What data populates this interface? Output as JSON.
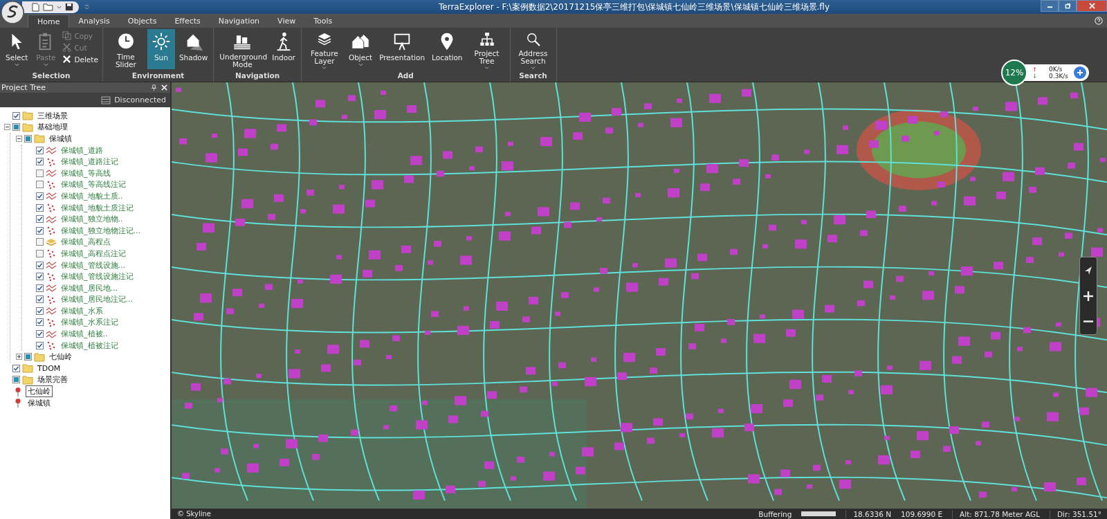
{
  "window": {
    "title": "TerraExplorer - F:\\案例数据2\\20171215保亭三维打包\\保城镇七仙岭三维场景\\保城镇七仙岭三维场景.fly"
  },
  "tabs": [
    {
      "label": "Home",
      "selected": true
    },
    {
      "label": "Analysis",
      "selected": false
    },
    {
      "label": "Objects",
      "selected": false
    },
    {
      "label": "Effects",
      "selected": false
    },
    {
      "label": "Navigation",
      "selected": false
    },
    {
      "label": "View",
      "selected": false
    },
    {
      "label": "Tools",
      "selected": false
    }
  ],
  "ribbon": [
    {
      "group": "Selection",
      "buttons": [
        {
          "kind": "large",
          "label": "Select",
          "dropdown": true,
          "disabled": false,
          "selected": false
        },
        {
          "kind": "large",
          "label": "Paste",
          "dropdown": true,
          "disabled": true,
          "selected": false
        },
        {
          "kind": "small",
          "label": "Copy",
          "disabled": true
        },
        {
          "kind": "small",
          "label": "Cut",
          "disabled": true
        },
        {
          "kind": "small",
          "label": "Delete",
          "disabled": false
        }
      ]
    },
    {
      "group": "Environment",
      "buttons": [
        {
          "kind": "large",
          "label": "Time Slider",
          "dropdown": false,
          "disabled": false,
          "selected": false
        },
        {
          "kind": "large",
          "label": "Sun",
          "dropdown": false,
          "disabled": false,
          "selected": true
        },
        {
          "kind": "large",
          "label": "Shadow",
          "dropdown": false,
          "disabled": false,
          "selected": false
        }
      ]
    },
    {
      "group": "Navigation",
      "buttons": [
        {
          "kind": "large",
          "label": "Underground Mode",
          "dropdown": false,
          "disabled": false,
          "selected": false
        },
        {
          "kind": "large",
          "label": "Indoor",
          "dropdown": false,
          "disabled": false,
          "selected": false
        }
      ]
    },
    {
      "group": "Add",
      "buttons": [
        {
          "kind": "large",
          "label": "Feature Layer",
          "dropdown": true,
          "disabled": false,
          "selected": false
        },
        {
          "kind": "large",
          "label": "Object",
          "dropdown": true,
          "disabled": false,
          "selected": false
        },
        {
          "kind": "large",
          "label": "Presentation",
          "dropdown": false,
          "disabled": false,
          "selected": false
        },
        {
          "kind": "large",
          "label": "Location",
          "dropdown": false,
          "disabled": false,
          "selected": false
        },
        {
          "kind": "large",
          "label": "Project Tree",
          "dropdown": true,
          "disabled": false,
          "selected": false
        }
      ]
    },
    {
      "group": "Search",
      "buttons": [
        {
          "kind": "large",
          "label": "Address Search",
          "dropdown": true,
          "disabled": false,
          "selected": false
        }
      ]
    }
  ],
  "project_tree": {
    "title": "Project Tree",
    "connection": "Disconnected",
    "items": [
      {
        "kind": "folder",
        "label": "三维场景",
        "checked": true,
        "mixed": false
      },
      {
        "kind": "folder",
        "label": "基础地理",
        "checked": false,
        "mixed": true,
        "expanded": true,
        "children": [
          {
            "kind": "folder",
            "label": "保城镇",
            "checked": false,
            "mixed": true,
            "expanded": true,
            "children": [
              {
                "kind": "line",
                "label": "保城镇_道路",
                "checked": true,
                "mixed": false
              },
              {
                "kind": "point",
                "label": "保城镇_道路注记",
                "checked": true,
                "mixed": false
              },
              {
                "kind": "line",
                "label": "保城镇_等高线",
                "checked": false,
                "mixed": false
              },
              {
                "kind": "point",
                "label": "保城镇_等高线注记",
                "checked": false,
                "mixed": false
              },
              {
                "kind": "line",
                "label": "保城镇_地貌土质..",
                "checked": true,
                "mixed": false
              },
              {
                "kind": "point",
                "label": "保城镇_地貌土质注记",
                "checked": true,
                "mixed": false
              },
              {
                "kind": "line",
                "label": "保城镇_独立地物..",
                "checked": true,
                "mixed": false
              },
              {
                "kind": "point",
                "label": "保城镇_独立地物注记...",
                "checked": true,
                "mixed": false
              },
              {
                "kind": "layer",
                "label": "保城镇_高程点",
                "checked": false,
                "mixed": false
              },
              {
                "kind": "point",
                "label": "保城镇_高程点注记",
                "checked": false,
                "mixed": false
              },
              {
                "kind": "line",
                "label": "保城镇_管线设施...",
                "checked": true,
                "mixed": false
              },
              {
                "kind": "point",
                "label": "保城镇_管线设施注记",
                "checked": true,
                "mixed": false
              },
              {
                "kind": "line",
                "label": "保城镇_居民地...",
                "checked": true,
                "mixed": false
              },
              {
                "kind": "point",
                "label": "保城镇_居民地注记...",
                "checked": true,
                "mixed": false
              },
              {
                "kind": "line",
                "label": "保城镇_水系",
                "checked": true,
                "mixed": false
              },
              {
                "kind": "point",
                "label": "保城镇_水系注记",
                "checked": true,
                "mixed": false
              },
              {
                "kind": "line",
                "label": "保城镇_植被..",
                "checked": true,
                "mixed": false
              },
              {
                "kind": "point",
                "label": "保城镇_植被注记",
                "checked": true,
                "mixed": false
              }
            ]
          },
          {
            "kind": "folder",
            "label": "七仙岭",
            "checked": false,
            "mixed": true,
            "expanded": false
          }
        ]
      },
      {
        "kind": "folder",
        "label": "TDOM",
        "checked": true,
        "mixed": false
      },
      {
        "kind": "folder",
        "label": "场景完善",
        "checked": false,
        "mixed": true
      },
      {
        "kind": "pin",
        "label": "七仙岭",
        "selected": true
      },
      {
        "kind": "pin",
        "label": "保城镇",
        "selected": false
      }
    ]
  },
  "network_widget": {
    "percent": "12%",
    "upload": "0K/s",
    "download": "0.3K/s"
  },
  "map": {
    "credit": "© Skyline"
  },
  "status_bar": {
    "buffering": "Buffering",
    "level": 1,
    "latitude": "18.6336 N",
    "longitude": "109.6990 E",
    "altitude": "Alt: 871.78 Meter AGL",
    "direction": "Dir: 351.51°"
  }
}
